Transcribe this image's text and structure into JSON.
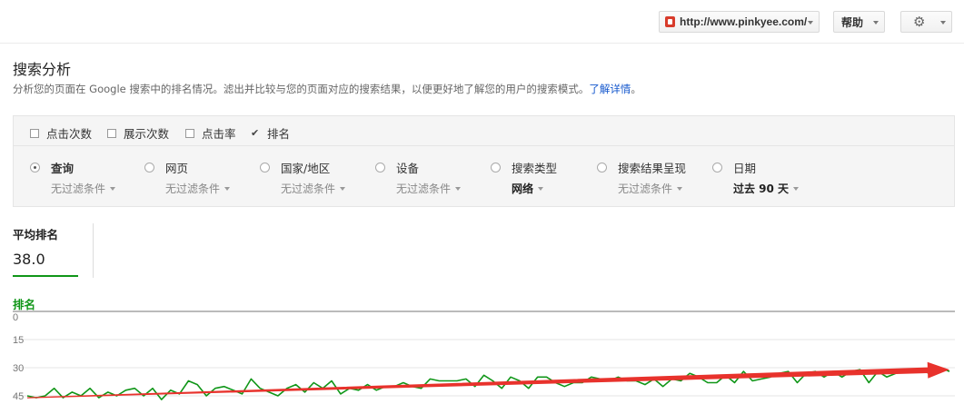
{
  "header": {
    "site_url": "http://www.pinkyee.com/",
    "help_label": "帮助",
    "gear_icon": "gear-icon"
  },
  "page": {
    "title": "搜索分析",
    "description": "分析您的页面在 Google 搜索中的排名情况。滤出并比较与您的页面对应的搜索结果，以便更好地了解您的用户的搜索模式。",
    "learn_more": "了解详情",
    "learn_more_suffix": "。"
  },
  "metrics": [
    {
      "label": "点击次数",
      "checked": false
    },
    {
      "label": "展示次数",
      "checked": false
    },
    {
      "label": "点击率",
      "checked": false
    },
    {
      "label": "排名",
      "checked": true
    }
  ],
  "dimensions": [
    {
      "label": "查询",
      "filter": "无过滤条件",
      "selected": true
    },
    {
      "label": "网页",
      "filter": "无过滤条件",
      "selected": false
    },
    {
      "label": "国家/地区",
      "filter": "无过滤条件",
      "selected": false
    },
    {
      "label": "设备",
      "filter": "无过滤条件",
      "selected": false
    },
    {
      "label": "搜索类型",
      "filter": "网络",
      "selected": false
    },
    {
      "label": "搜索结果呈现",
      "filter": "无过滤条件",
      "selected": false
    },
    {
      "label": "日期",
      "filter": "过去 90 天",
      "selected": false
    }
  ],
  "summary": {
    "label": "平均排名",
    "value": "38.0"
  },
  "chart_data": {
    "type": "line",
    "series": [
      {
        "name": "排名",
        "color": "#109618",
        "values": [
          45,
          46,
          45,
          41,
          46,
          43,
          45,
          41,
          46,
          43,
          45,
          42,
          41,
          45,
          41,
          47,
          42,
          44,
          37,
          39,
          45,
          41,
          40,
          42,
          44,
          36,
          41,
          43,
          45,
          41,
          39,
          43,
          38,
          41,
          37,
          44,
          41,
          42,
          39,
          42,
          40,
          40,
          38,
          40,
          41,
          36,
          37,
          37,
          37,
          36,
          40,
          34,
          37,
          41,
          35,
          37,
          41,
          35,
          35,
          38,
          40,
          38,
          38,
          35,
          36,
          37,
          35,
          37,
          37,
          39,
          36,
          40,
          36,
          37,
          33,
          35,
          38,
          38,
          34,
          38,
          32,
          37,
          36,
          35,
          33,
          32,
          38,
          33,
          32,
          35,
          32,
          35,
          32,
          31,
          38,
          32,
          35,
          33,
          32,
          32,
          31,
          34,
          30,
          32
        ]
      }
    ],
    "yaxis": {
      "ticks": [
        0,
        15,
        30,
        45
      ],
      "reversed": true,
      "range": [
        0,
        45
      ]
    },
    "annotation": {
      "type": "arrow",
      "color": "#e8322c",
      "from": [
        0,
        46
      ],
      "to": [
        103,
        31
      ]
    }
  }
}
